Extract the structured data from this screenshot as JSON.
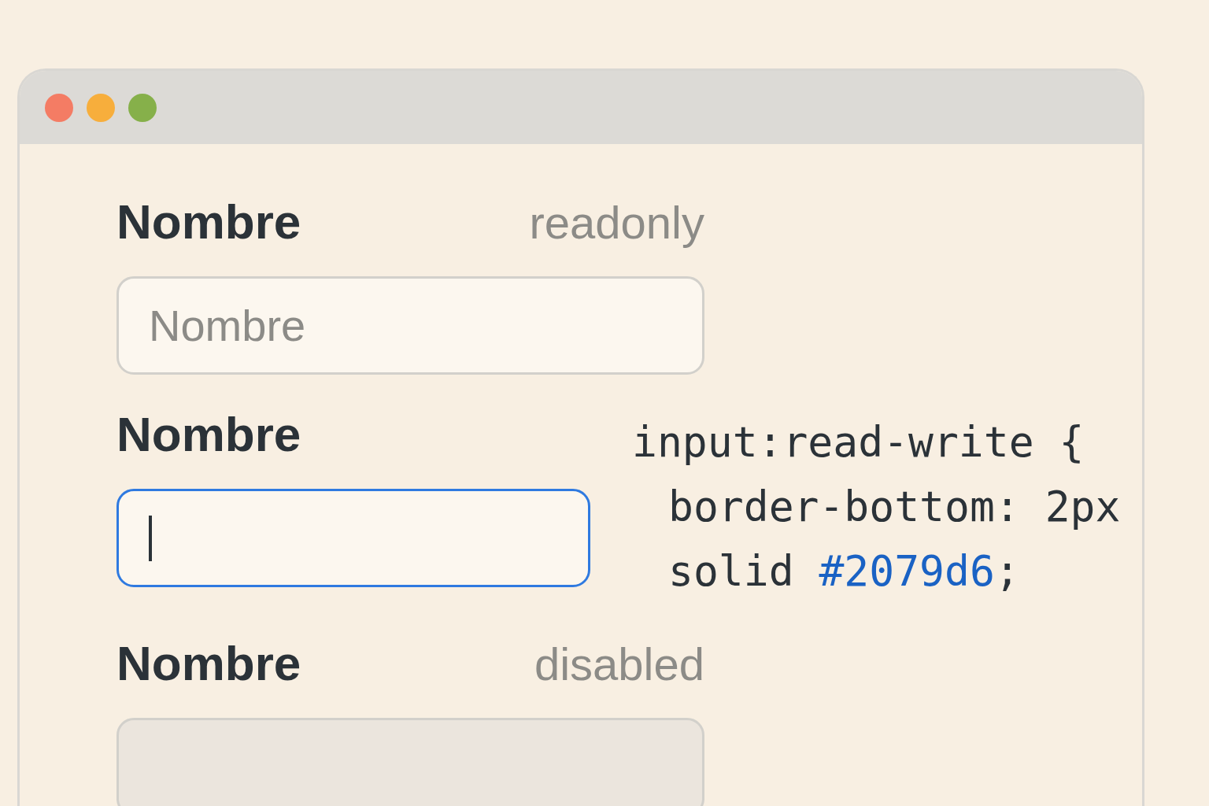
{
  "fields": [
    {
      "label": "Nombre",
      "tag": "readonly",
      "kind": "readonly",
      "placeholder": "Nombre"
    },
    {
      "label": "Nombre",
      "kind": "focused"
    },
    {
      "label": "Nombre",
      "tag": "disabled",
      "kind": "disabled"
    }
  ],
  "code": [
    {
      "indented": false,
      "segments": [
        {
          "kind": "plain",
          "text": "input:read-write {"
        }
      ]
    },
    {
      "indented": true,
      "segments": [
        {
          "kind": "plain",
          "text": "border-bottom: 2px"
        }
      ]
    },
    {
      "indented": true,
      "segments": [
        {
          "kind": "plain",
          "text": "solid "
        },
        {
          "kind": "value",
          "text": "#2079d6"
        },
        {
          "kind": "plain",
          "text": ";"
        }
      ]
    }
  ]
}
